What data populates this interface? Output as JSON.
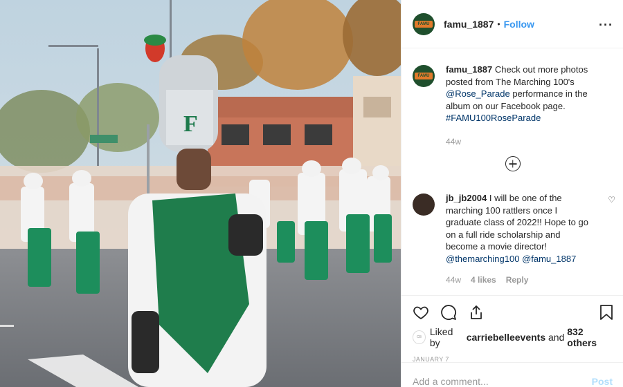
{
  "header": {
    "avatar_text": "FAMU",
    "username": "famu_1887",
    "separator": "•",
    "follow_label": "Follow",
    "more_label": "···"
  },
  "caption": {
    "username": "famu_1887",
    "text": " Check out more photos posted from The Marching 100's ",
    "mention": "@Rose_Parade",
    "text2": " performance in the album on our Facebook page. ",
    "hashtag": "#FAMU100RoseParade",
    "age": "44w"
  },
  "reply": {
    "username": "jb_jb2004",
    "text": " I will be one of the marching 100 rattlers once I graduate class of 2022!! Hope to go on a full ride scholarship and become a movie director! ",
    "mention1": "@themarching100",
    "mention2": "@famu_1887",
    "age": "44w",
    "likes": "4 likes",
    "reply_label": "Reply",
    "heart_icon": "♡"
  },
  "likes": {
    "avatar_text": "CB",
    "prefix": "Liked by ",
    "user": "carriebelleevents",
    "middle": " and ",
    "others": "832 others"
  },
  "date": "JANUARY 7",
  "composer": {
    "placeholder": "Add a comment...",
    "post_label": "Post"
  },
  "colors": {
    "accent": "#3897f0",
    "link": "#003569",
    "famu_green": "#1f4f2d",
    "famu_orange": "#e27a2b"
  }
}
